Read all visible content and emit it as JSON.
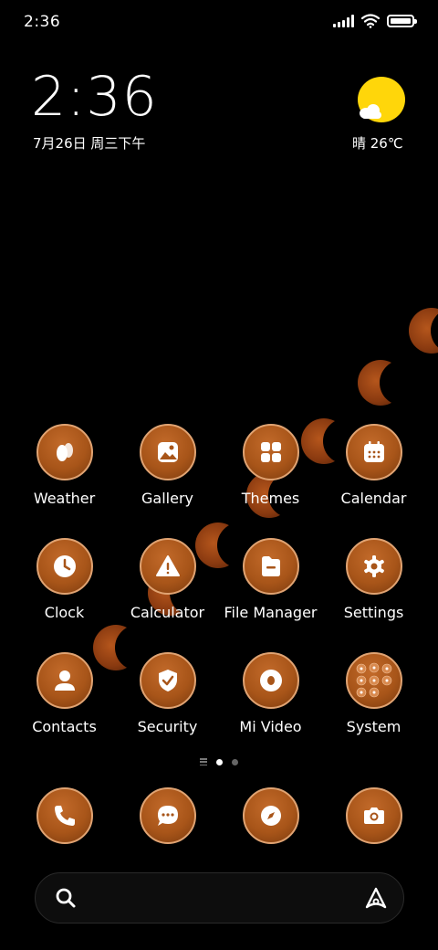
{
  "status": {
    "time": "2:36"
  },
  "widget": {
    "time": "2:36",
    "date": "7月26日 周三下午",
    "weather": "晴 26℃"
  },
  "apps": [
    {
      "label": "Weather",
      "icon": "weather-icon"
    },
    {
      "label": "Gallery",
      "icon": "gallery-icon"
    },
    {
      "label": "Themes",
      "icon": "themes-icon"
    },
    {
      "label": "Calendar",
      "icon": "calendar-icon"
    },
    {
      "label": "Clock",
      "icon": "clock-icon"
    },
    {
      "label": "Calculator",
      "icon": "calculator-icon"
    },
    {
      "label": "File Manager",
      "icon": "file-manager-icon"
    },
    {
      "label": "Settings",
      "icon": "settings-icon"
    },
    {
      "label": "Contacts",
      "icon": "contacts-icon"
    },
    {
      "label": "Security",
      "icon": "security-icon"
    },
    {
      "label": "Mi Video",
      "icon": "mi-video-icon"
    },
    {
      "label": "System",
      "icon": "folder-icon"
    }
  ],
  "dock": [
    {
      "icon": "phone-icon"
    },
    {
      "icon": "messages-icon"
    },
    {
      "icon": "browser-icon"
    },
    {
      "icon": "camera-icon"
    }
  ],
  "colors": {
    "accent": "#a85519",
    "sun": "#ffd60a"
  }
}
